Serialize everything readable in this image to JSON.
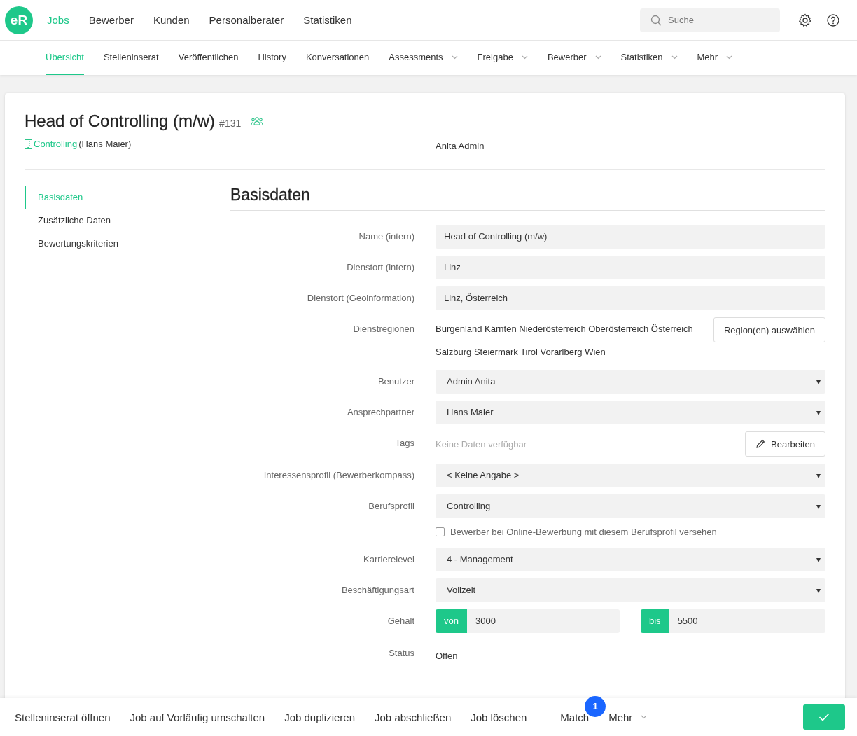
{
  "top_nav": {
    "logo": "eR",
    "items": [
      {
        "label": "Jobs",
        "selected": true
      },
      {
        "label": "Bewerber",
        "selected": false
      },
      {
        "label": "Kunden",
        "selected": false
      },
      {
        "label": "Personalberater",
        "selected": false
      },
      {
        "label": "Statistiken",
        "selected": false
      }
    ],
    "search": {
      "placeholder": "Suche"
    }
  },
  "sub_nav": {
    "items": [
      {
        "label": "Übersicht",
        "selected": true,
        "has_menu": false
      },
      {
        "label": "Stelleninserat",
        "selected": false,
        "has_menu": false
      },
      {
        "label": "Veröffentlichen",
        "selected": false,
        "has_menu": false
      },
      {
        "label": "History",
        "selected": false,
        "has_menu": false
      },
      {
        "label": "Konversationen",
        "selected": false,
        "has_menu": false
      },
      {
        "label": "Assessments",
        "selected": false,
        "has_menu": true
      },
      {
        "label": "Freigabe",
        "selected": false,
        "has_menu": true
      },
      {
        "label": "Bewerber",
        "selected": false,
        "has_menu": true
      },
      {
        "label": "Statistiken",
        "selected": false,
        "has_menu": true
      },
      {
        "label": "Mehr",
        "selected": false,
        "has_menu": true
      }
    ]
  },
  "job": {
    "title": "Head of Controlling (m/w)",
    "number": "#131",
    "department": "Controlling",
    "contact": "(Hans Maier)",
    "owner": "Anita Admin"
  },
  "side_menu": {
    "items": [
      {
        "label": "Basisdaten",
        "selected": true
      },
      {
        "label": "Zusätzliche Daten",
        "selected": false
      },
      {
        "label": "Bewertungskriterien",
        "selected": false
      }
    ]
  },
  "section_title": "Basisdaten",
  "form": {
    "rows": [
      {
        "kind": "text",
        "label": "Name (intern)",
        "value": "Head of Controlling (m/w)"
      },
      {
        "kind": "text",
        "label": "Dienstort (intern)",
        "value": "Linz"
      },
      {
        "kind": "text",
        "label": "Dienstort (Geoinformation)",
        "value": "Linz, Österreich"
      },
      {
        "kind": "regions",
        "label": "Dienstregionen",
        "lines": [
          "Burgenland Kärnten Niederösterreich Oberösterreich Österreich",
          "Salzburg Steiermark Tirol Vorarlberg Wien"
        ],
        "button": "Region(en) auswählen"
      },
      {
        "kind": "select",
        "label": "Benutzer",
        "value": "Admin Anita",
        "focused": false
      },
      {
        "kind": "select",
        "label": "Ansprechpartner",
        "value": "Hans Maier",
        "focused": false
      },
      {
        "kind": "tags",
        "label": "Tags",
        "placeholder": "Keine Daten verfügbar",
        "button": "Bearbeiten"
      },
      {
        "kind": "select",
        "label": "Interessensprofil (Bewerberkompass)",
        "value": "< Keine Angabe >",
        "focused": false
      },
      {
        "kind": "select",
        "label": "Berufsprofil",
        "value": "Controlling",
        "focused": false
      },
      {
        "kind": "checkbox",
        "text": "Bewerber bei Online-Bewerbung mit diesem Berufsprofil versehen",
        "checked": false
      },
      {
        "kind": "select",
        "label": "Karrierelevel",
        "value": "4 - Management",
        "focused": true
      },
      {
        "kind": "select",
        "label": "Beschäftigungsart",
        "value": "Vollzeit",
        "focused": false
      },
      {
        "kind": "range",
        "label": "Gehalt",
        "from_label": "von",
        "from": "3000",
        "to_label": "bis",
        "to": "5500"
      },
      {
        "kind": "status",
        "label": "Status",
        "value": "Offen"
      }
    ]
  },
  "footer": {
    "actions": [
      {
        "label": "Stelleninserat öffnen",
        "has_menu": false
      },
      {
        "label": "Job auf Vorläufig umschalten",
        "has_menu": false
      },
      {
        "label": "Job duplizieren",
        "has_menu": false
      },
      {
        "label": "Job abschließen",
        "has_menu": false
      },
      {
        "label": "Job löschen",
        "has_menu": false
      },
      {
        "label": "Match",
        "has_menu": false,
        "badge": "1"
      },
      {
        "label": "Mehr",
        "has_menu": true
      }
    ]
  }
}
